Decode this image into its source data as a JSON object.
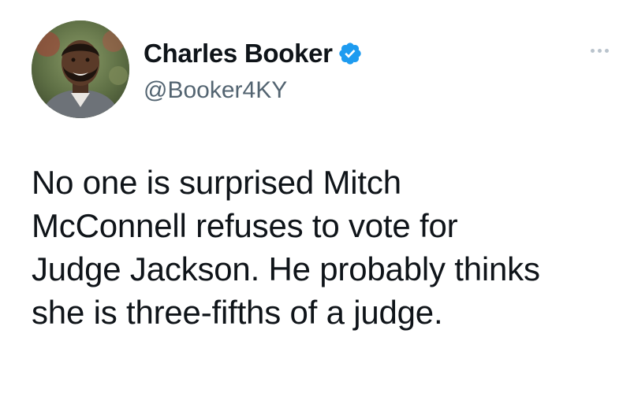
{
  "author": {
    "display_name": "Charles Booker",
    "handle": "@Booker4KY",
    "verified": true,
    "verified_color": "#1d9bf0"
  },
  "tweet": {
    "lines": [
      "No one is surprised Mitch",
      "McConnell refuses to vote for",
      "Judge Jackson. He probably thinks",
      "she is three-fifths of a judge."
    ]
  },
  "icons": {
    "more": "more-options-icon",
    "verified": "verified-badge-icon"
  }
}
